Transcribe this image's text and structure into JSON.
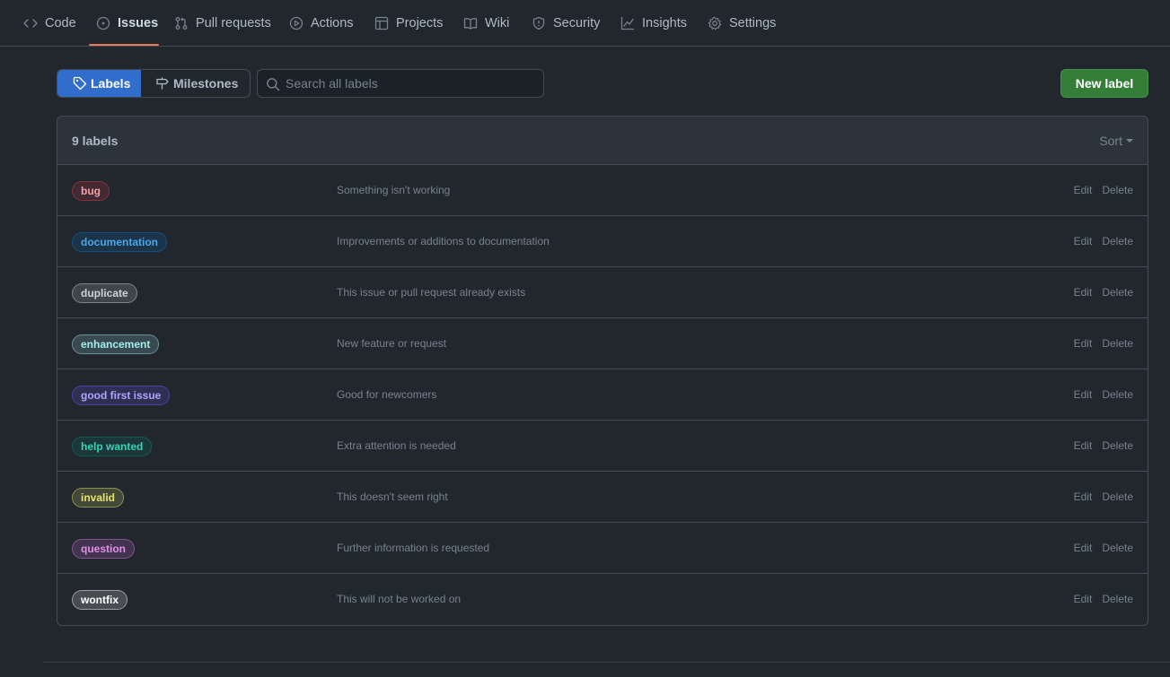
{
  "nav": {
    "items": [
      {
        "label": "Code",
        "icon": "code-icon"
      },
      {
        "label": "Issues",
        "icon": "issue-opened-icon",
        "selected": true
      },
      {
        "label": "Pull requests",
        "icon": "git-pull-request-icon"
      },
      {
        "label": "Actions",
        "icon": "play-icon"
      },
      {
        "label": "Projects",
        "icon": "table-icon"
      },
      {
        "label": "Wiki",
        "icon": "book-icon"
      },
      {
        "label": "Security",
        "icon": "shield-icon"
      },
      {
        "label": "Insights",
        "icon": "graph-icon"
      },
      {
        "label": "Settings",
        "icon": "gear-icon"
      }
    ],
    "accent": "#ec775c"
  },
  "subnav": {
    "labels_tab": "Labels",
    "milestones_tab": "Milestones",
    "search_placeholder": "Search all labels",
    "new_label_button": "New label"
  },
  "labels_box": {
    "count_text": "9 labels",
    "sort_label": "Sort"
  },
  "labels": [
    {
      "name": "bug",
      "description": "Something isn't working",
      "color": "#d73a4a",
      "text_color": "#f0a3ab",
      "edit": "Edit",
      "delete": "Delete"
    },
    {
      "name": "documentation",
      "description": "Improvements or additions to documentation",
      "color": "#0075ca",
      "text_color": "#4aa7ec",
      "edit": "Edit",
      "delete": "Delete"
    },
    {
      "name": "duplicate",
      "description": "This issue or pull request already exists",
      "color": "#cfd3d7",
      "text_color": "#cfd3d7",
      "edit": "Edit",
      "delete": "Delete"
    },
    {
      "name": "enhancement",
      "description": "New feature or request",
      "color": "#a2eeef",
      "text_color": "#a2eeef",
      "edit": "Edit",
      "delete": "Delete"
    },
    {
      "name": "good first issue",
      "description": "Good for newcomers",
      "color": "#7057ff",
      "text_color": "#b0a4ff",
      "edit": "Edit",
      "delete": "Delete"
    },
    {
      "name": "help wanted",
      "description": "Extra attention is needed",
      "color": "#008672",
      "text_color": "#2fd6b8",
      "edit": "Edit",
      "delete": "Delete"
    },
    {
      "name": "invalid",
      "description": "This doesn't seem right",
      "color": "#e4e669",
      "text_color": "#e4e669",
      "edit": "Edit",
      "delete": "Delete"
    },
    {
      "name": "question",
      "description": "Further information is requested",
      "color": "#d876e3",
      "text_color": "#e390ed",
      "edit": "Edit",
      "delete": "Delete"
    },
    {
      "name": "wontfix",
      "description": "This will not be worked on",
      "color": "#ffffff",
      "text_color": "#ffffff",
      "edit": "Edit",
      "delete": "Delete"
    }
  ],
  "colors": {
    "background": "#22272e",
    "primary_button": "#347d39",
    "selected_tab": "#316dca"
  }
}
